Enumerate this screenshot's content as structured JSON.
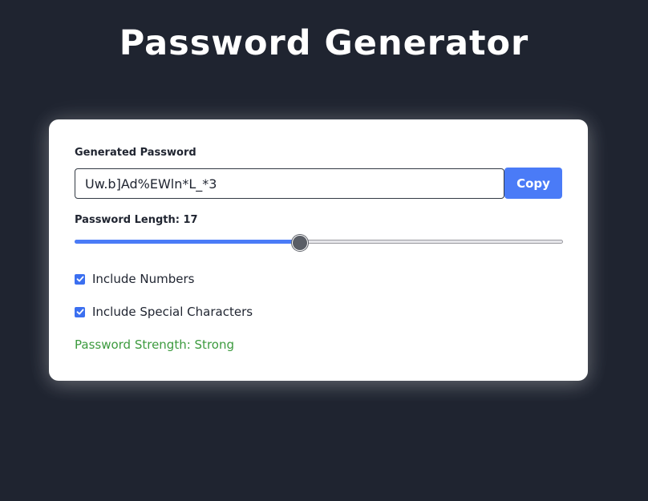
{
  "header": {
    "title": "Password Generator"
  },
  "generator": {
    "password_label": "Generated Password",
    "password_value": "Uw.b]Ad%EWln*L_*3",
    "copy_label": "Copy",
    "length_label": "Password Length: 17",
    "length_fraction": 0.46,
    "options": {
      "numbers_label": "Include Numbers",
      "numbers_checked": true,
      "special_label": "Include Special Characters",
      "special_checked": true
    },
    "strength_text": "Password Strength: Strong"
  },
  "colors": {
    "background": "#1f2430",
    "accent": "#4a7bf7",
    "strength_strong": "#3c9a3e"
  },
  "icons": {
    "checkbox_checked": "checkmark-icon"
  }
}
